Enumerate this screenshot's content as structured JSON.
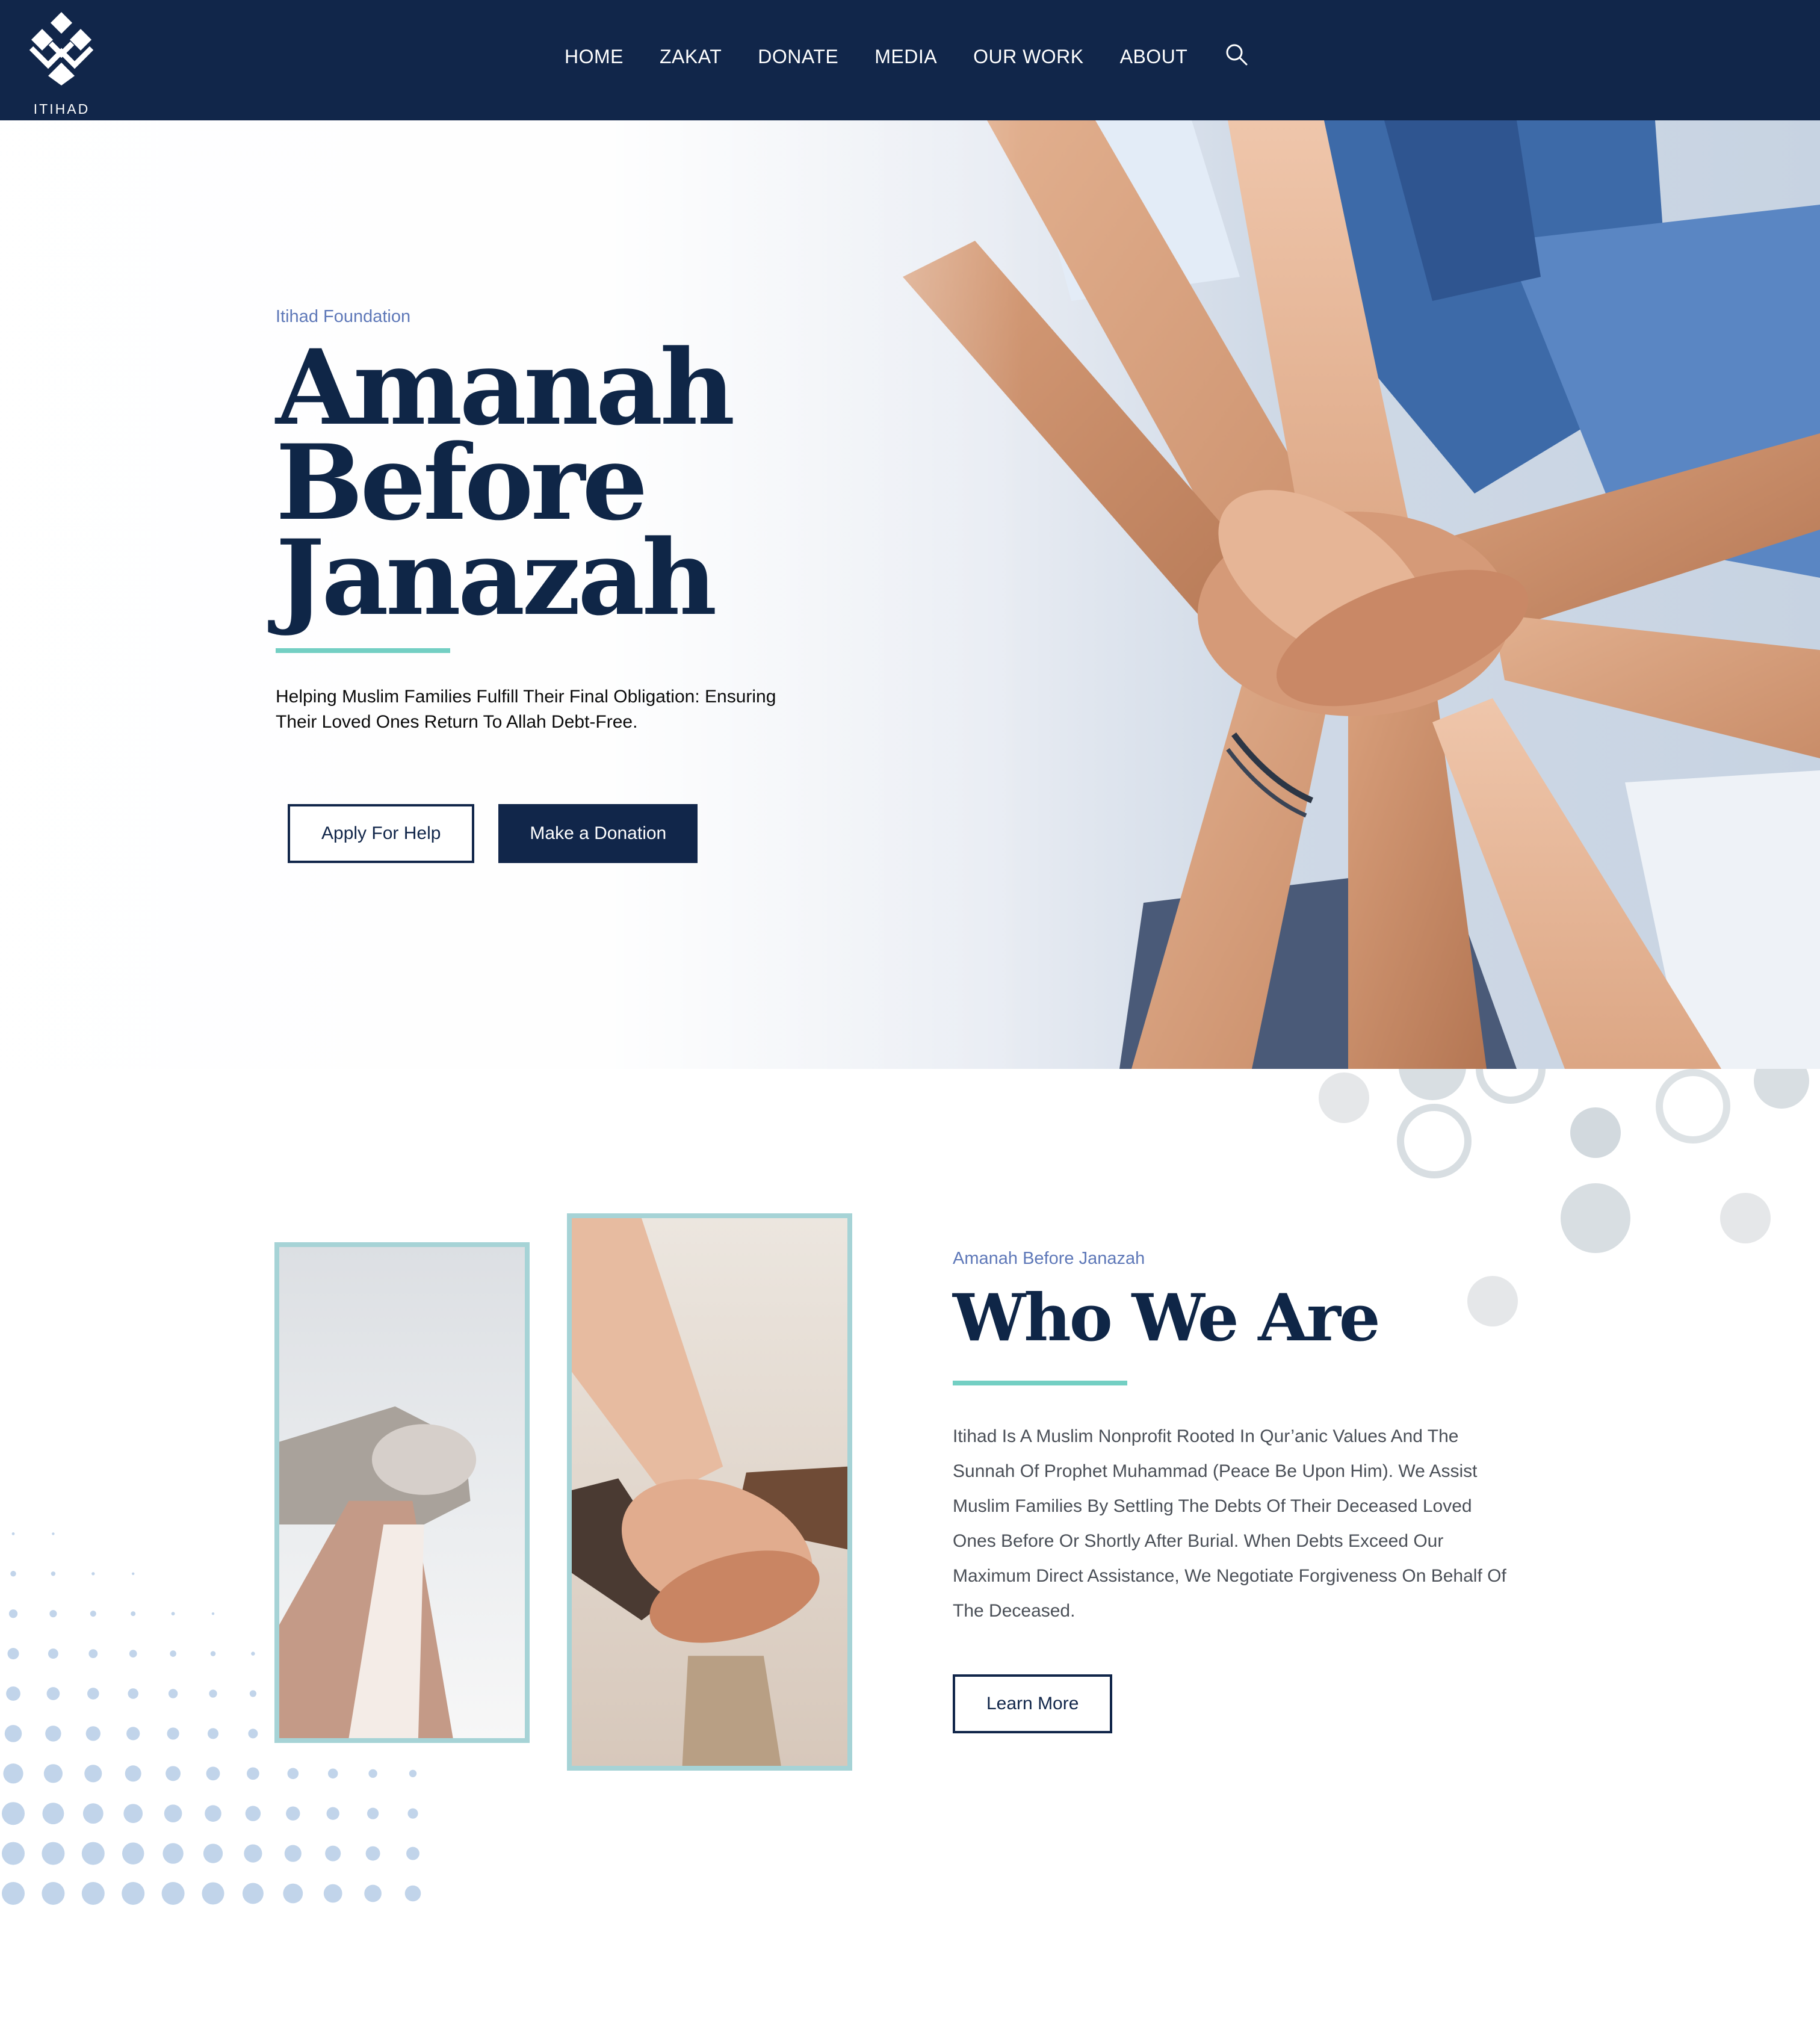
{
  "brand": {
    "name": "ITIHAD"
  },
  "nav": {
    "items": [
      {
        "label": "HOME"
      },
      {
        "label": "ZAKAT"
      },
      {
        "label": "DONATE"
      },
      {
        "label": "MEDIA"
      },
      {
        "label": "OUR WORK"
      },
      {
        "label": "ABOUT"
      }
    ],
    "search_icon": "search-icon"
  },
  "hero": {
    "eyebrow": "Itihad Foundation",
    "title_lines": [
      "Amanah",
      "Before",
      "Janazah"
    ],
    "subtitle": "Helping Muslim Families Fulfill Their Final Obligation: Ensuring Their Loved Ones Return To Allah Debt-Free.",
    "buttons": {
      "apply": "Apply For Help",
      "donate": "Make a Donation"
    }
  },
  "about": {
    "eyebrow": "Amanah Before Janazah",
    "title": "Who We Are",
    "body": "Itihad Is A Muslim Nonprofit Rooted In Qur’anic Values And The Sunnah Of Prophet Muhammad (Peace Be Upon Him). We Assist Muslim Families By Settling The Debts Of Their Deceased Loved Ones Before Or Shortly After Burial. When Debts Exceed Our Maximum Direct Assistance, We Negotiate Forgiveness On Behalf Of The Deceased.",
    "button": "Learn More"
  },
  "colors": {
    "navy": "#11264a",
    "accent": "#73cfc3",
    "eyebrow": "#5e78b8",
    "frame": "#a6d3d6",
    "dots": "#c1d4ea"
  }
}
